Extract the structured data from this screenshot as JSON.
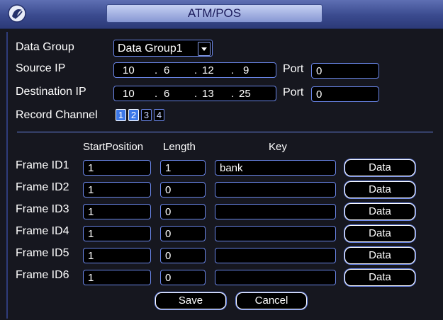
{
  "window": {
    "title": "ATM/POS",
    "logo_icon": "dahua-logo-icon"
  },
  "form": {
    "data_group": {
      "label": "Data Group",
      "value": "Data Group1"
    },
    "source_ip": {
      "label": "Source IP",
      "octets": [
        "10",
        "6",
        "12",
        "9"
      ],
      "port_label": "Port",
      "port": "0"
    },
    "destination_ip": {
      "label": "Destination IP",
      "octets": [
        "10",
        "6",
        "13",
        "25"
      ],
      "port_label": "Port",
      "port": "0"
    },
    "record_channel": {
      "label": "Record Channel",
      "channels": [
        {
          "label": "1",
          "selected": true
        },
        {
          "label": "2",
          "selected": true
        },
        {
          "label": "3",
          "selected": false
        },
        {
          "label": "4",
          "selected": false
        }
      ]
    },
    "ip_separator": "."
  },
  "table": {
    "headers": {
      "start": "StartPosition",
      "length": "Length",
      "key": "Key"
    },
    "rows": [
      {
        "label": "Frame ID1",
        "start": "1",
        "length": "1",
        "key": "bank",
        "button": "Data"
      },
      {
        "label": "Frame ID2",
        "start": "1",
        "length": "0",
        "key": "",
        "button": "Data"
      },
      {
        "label": "Frame ID3",
        "start": "1",
        "length": "0",
        "key": "",
        "button": "Data"
      },
      {
        "label": "Frame ID4",
        "start": "1",
        "length": "0",
        "key": "",
        "button": "Data"
      },
      {
        "label": "Frame ID5",
        "start": "1",
        "length": "0",
        "key": "",
        "button": "Data"
      },
      {
        "label": "Frame ID6",
        "start": "1",
        "length": "0",
        "key": "",
        "button": "Data"
      }
    ]
  },
  "footer": {
    "save": "Save",
    "cancel": "Cancel"
  },
  "colors": {
    "title_bar": "#3a4a8e",
    "field_border": "#6a86e8",
    "channel_selected": "#3c78e8"
  }
}
